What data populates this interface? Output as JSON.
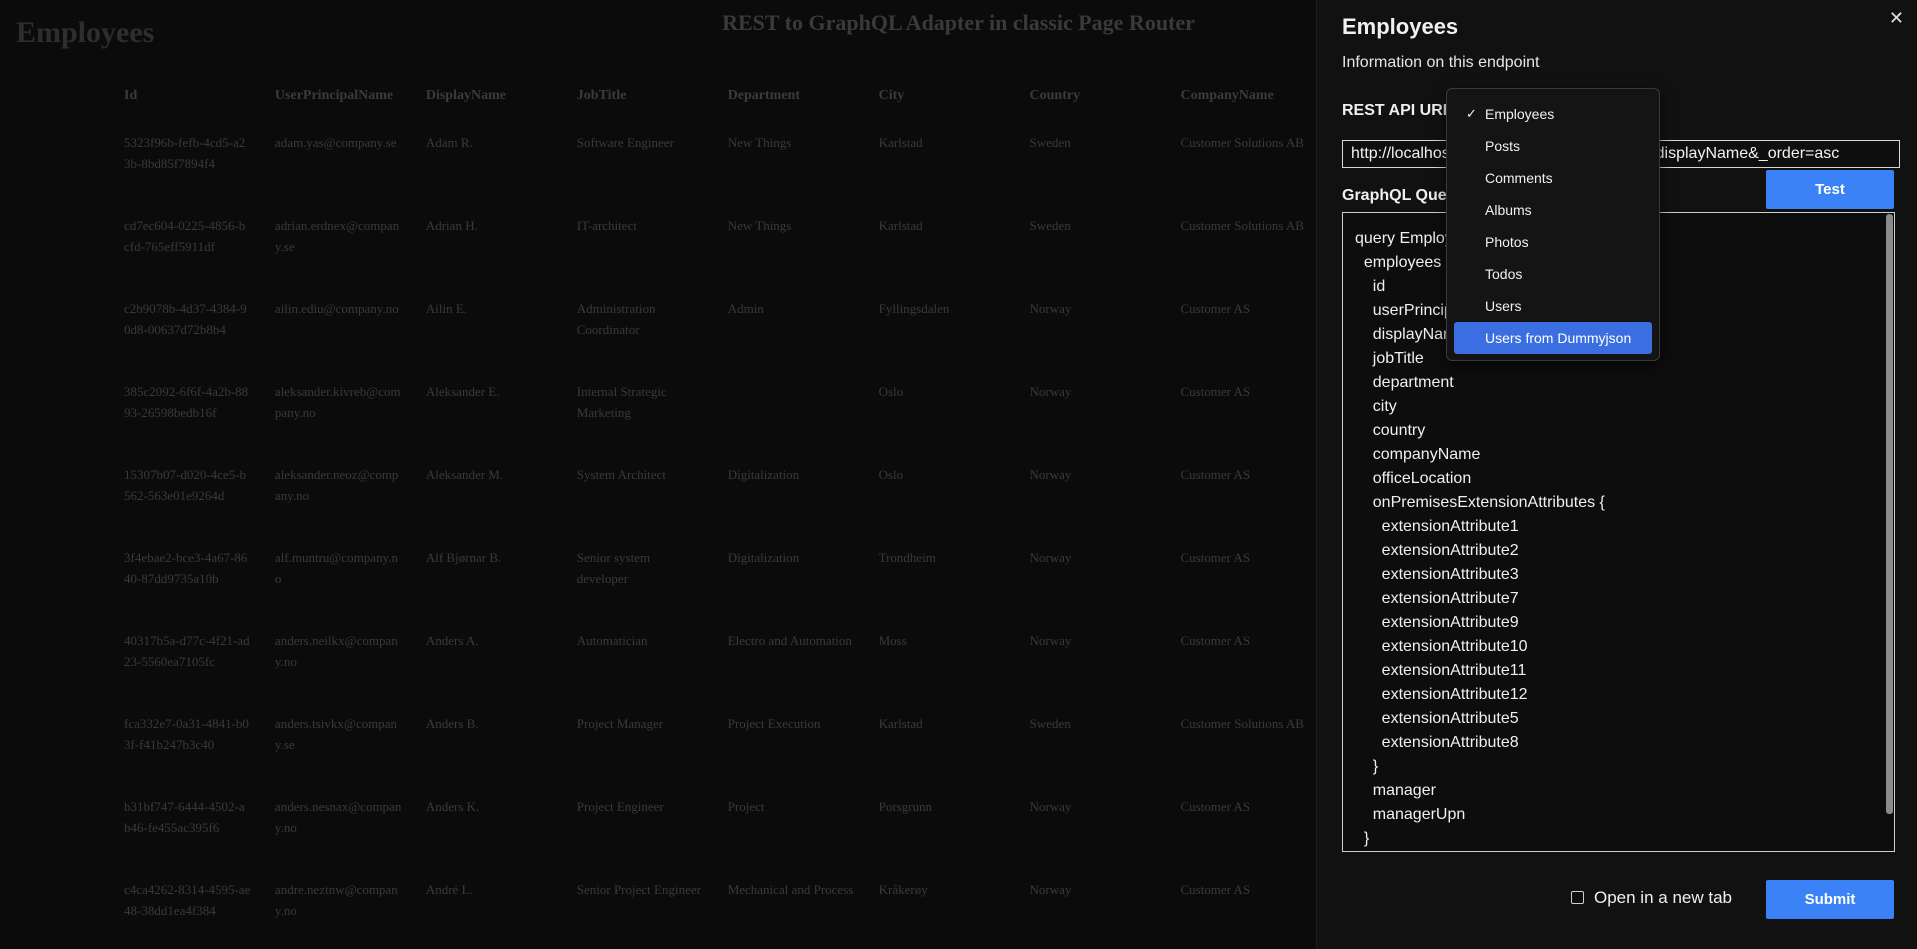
{
  "page": {
    "heading": "Employees",
    "app_title": "REST to GraphQL Adapter in classic Page Router"
  },
  "table": {
    "columns": [
      "Id",
      "UserPrincipalName",
      "DisplayName",
      "JobTitle",
      "Department",
      "City",
      "Country",
      "CompanyName"
    ],
    "rows": [
      [
        "5323f96b-fefb-4cd5-a23b-8bd85f7894f4",
        "adam.yas@company.se",
        "Adam R.",
        "Software Engineer",
        "New Things",
        "Karlstad",
        "Sweden",
        "Customer Solutions AB"
      ],
      [
        "cd7ec604-0225-4856-bcfd-765eff5911df",
        "adrian.erdnex@company.se",
        "Adrian H.",
        "IT-architect",
        "New Things",
        "Karlstad",
        "Sweden",
        "Customer Solutions AB"
      ],
      [
        "c2b9078b-4d37-4384-90d8-00637d72b8b4",
        "ailin.ediu@company.no",
        "Ailin E.",
        "Administration Coordinator",
        "Admin",
        "Fyllingsdalen",
        "Norway",
        "Customer AS"
      ],
      [
        "385c2092-6f6f-4a2b-8893-26598bedb16f",
        "aleksander.kivreb@company.no",
        "Aleksander E.",
        "Internal Strategic Marketing",
        "",
        "Oslo",
        "Norway",
        "Customer AS"
      ],
      [
        "15307b07-d020-4ce5-b562-563e01e9264d",
        "aleksander.neoz@company.no",
        "Aleksander M.",
        "System Architect",
        "Digitalization",
        "Oslo",
        "Norway",
        "Customer AS"
      ],
      [
        "3f4ebae2-bce3-4a67-8640-87dd9735a10b",
        "alf.muntru@company.no",
        "Alf Bjørnar B.",
        "Senior system developer",
        "Digitalization",
        "Trondheim",
        "Norway",
        "Customer AS"
      ],
      [
        "40317b5a-d77c-4f21-ad23-5560ea7105fc",
        "anders.neilkx@company.no",
        "Anders A.",
        "Automatician",
        "Electro and Automation",
        "Moss",
        "Norway",
        "Customer AS"
      ],
      [
        "fca332e7-0a31-4841-b03f-f41b247b3c40",
        "anders.tsivkx@company.se",
        "Anders B.",
        "Project Manager",
        "Project Execution",
        "Karlstad",
        "Sweden",
        "Customer Solutions AB"
      ],
      [
        "b31bf747-6444-4502-ab46-fe455ac395f6",
        "anders.nesnax@company.no",
        "Anders K.",
        "Project Engineer",
        "Project",
        "Porsgrunn",
        "Norway",
        "Customer AS"
      ],
      [
        "c4ca4262-8314-4595-ae48-38dd1ea4f384",
        "andre.neztnw@company.no",
        "André L.",
        "Senior Project Engineer",
        "Mechanical and Process",
        "Kråkerøy",
        "Norway",
        "Customer AS"
      ]
    ]
  },
  "drawer": {
    "title": "Employees",
    "subtitle": "Information on this endpoint",
    "close_glyph": "✕",
    "rest_label": "REST API URL",
    "rest_url": "http://localhost:3000/api/employees?_sort=displayName&_order=asc",
    "graphql_label": "GraphQL Query",
    "test_label": "Test",
    "graphql_query": "query Employees {\n  employees {\n    id\n    userPrincipalName\n    displayName\n    jobTitle\n    department\n    city\n    country\n    companyName\n    officeLocation\n    onPremisesExtensionAttributes {\n      extensionAttribute1\n      extensionAttribute2\n      extensionAttribute3\n      extensionAttribute7\n      extensionAttribute9\n      extensionAttribute10\n      extensionAttribute11\n      extensionAttribute12\n      extensionAttribute5\n      extensionAttribute8\n    }\n    manager\n    managerUpn\n  }\n}",
    "open_new_tab_label": "Open in a new tab",
    "open_new_tab_checked": false,
    "submit_label": "Submit"
  },
  "endpoint_menu": {
    "selected": "Employees",
    "highlighted": "Users from Dummyjson",
    "check_glyph": "✓",
    "options": [
      "Employees",
      "Posts",
      "Comments",
      "Albums",
      "Photos",
      "Todos",
      "Users",
      "Users from Dummyjson"
    ]
  },
  "colors": {
    "accent": "#3b82f6",
    "menu_highlight": "#3b6ee0",
    "background": "#0b0b0b",
    "drawer_background": "#111111"
  }
}
